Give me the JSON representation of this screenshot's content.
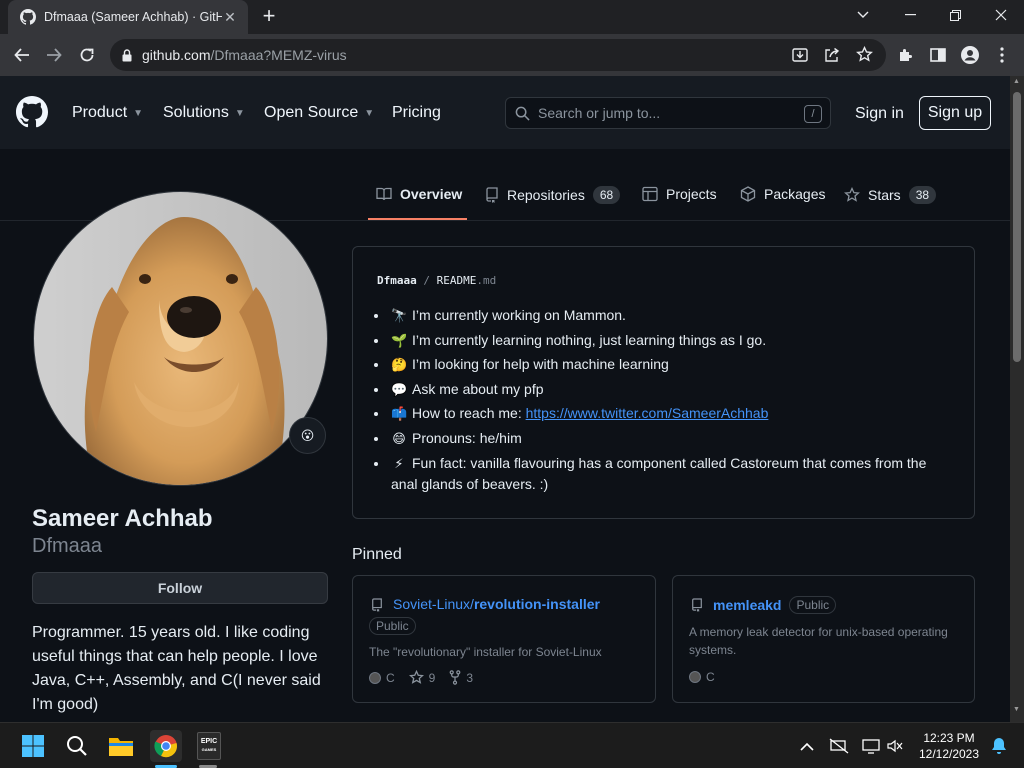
{
  "browser": {
    "tab_title": "Dfmaaa (Sameer Achhab) · GitHub",
    "url_host": "github.com",
    "url_path": "/Dfmaaa?MEMZ-virus"
  },
  "header": {
    "nav": [
      {
        "label": "Product",
        "dropdown": true
      },
      {
        "label": "Solutions",
        "dropdown": true
      },
      {
        "label": "Open Source",
        "dropdown": true
      },
      {
        "label": "Pricing",
        "dropdown": false
      }
    ],
    "search_placeholder": "Search or jump to...",
    "search_shortcut": "/",
    "signin": "Sign in",
    "signup": "Sign up"
  },
  "tabs": [
    {
      "label": "Overview",
      "icon": "book-icon",
      "active": true
    },
    {
      "label": "Repositories",
      "icon": "repo-icon",
      "count": "68"
    },
    {
      "label": "Projects",
      "icon": "table-icon"
    },
    {
      "label": "Packages",
      "icon": "package-icon"
    },
    {
      "label": "Stars",
      "icon": "star-icon",
      "count": "38"
    }
  ],
  "profile": {
    "fullname": "Sameer Achhab",
    "username": "Dfmaaa",
    "follow_label": "Follow",
    "bio": "Programmer. 15 years old. I like coding useful things that can help people. I love Java, C++, Assembly, and C(I never said I'm good)",
    "status_emoji": "😮"
  },
  "readme": {
    "owner": "Dfmaaa",
    "sep": "/",
    "file": "README",
    "ext": ".md",
    "items": [
      {
        "emoji": "🔭",
        "text": "I’m currently working on Mammon."
      },
      {
        "emoji": "🌱",
        "text": "I’m currently learning nothing, just learning things as I go."
      },
      {
        "emoji": "🤔",
        "text": "I’m looking for help with machine learning"
      },
      {
        "emoji": "💬",
        "text": "Ask me about my pfp"
      },
      {
        "emoji": "📫",
        "text": "How to reach me: ",
        "link": "https://www.twitter.com/SameerAchhab"
      },
      {
        "emoji": "😄",
        "text": "Pronouns: he/him"
      },
      {
        "emoji": "⚡",
        "text": "Fun fact: vanilla flavouring has a component called Castoreum that comes from the anal glands of beavers. :)"
      }
    ]
  },
  "pinned": {
    "title": "Pinned",
    "repos": [
      {
        "owner": "Soviet-Linux/",
        "name": "revolution-installer",
        "visibility": "Public",
        "description": "The \"revolutionary\" installer for Soviet-Linux",
        "language": "C",
        "stars": "9",
        "forks": "3"
      },
      {
        "owner": "",
        "name": "memleakd",
        "visibility": "Public",
        "description": "A memory leak detector for unix-based operating systems.",
        "language": "C"
      }
    ]
  },
  "taskbar": {
    "time": "12:23 PM",
    "date": "12/12/2023",
    "epic_label_1": "EPIC",
    "epic_label_2": "GAMES"
  },
  "colors": {
    "bg": "#0d1117",
    "header_bg": "#161b22",
    "link": "#4493f8",
    "tab_underline": "#f78166",
    "muted": "#7d8590"
  }
}
